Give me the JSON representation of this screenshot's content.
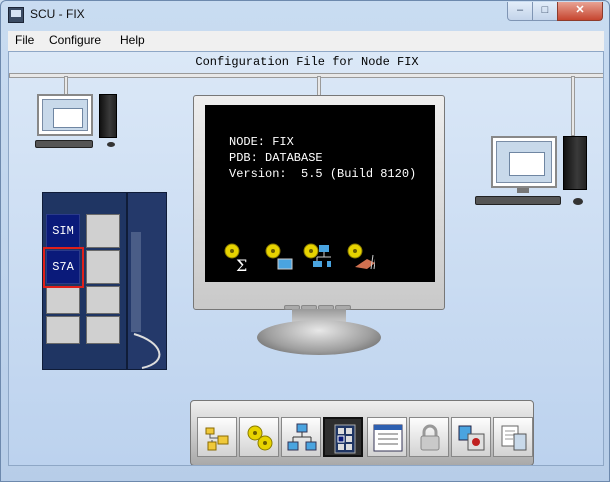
{
  "window": {
    "title": "SCU - FIX",
    "close_glyph": "✕",
    "max_glyph": "□",
    "min_glyph": "–"
  },
  "menu": [
    "File",
    "Configure",
    "Help"
  ],
  "caption": "Configuration File for Node FIX",
  "screen": {
    "node": "NODE: FIX",
    "pdb": "PDB: DATABASE",
    "version": "Version:  5.5 (Build 8120)",
    "sigma": "Σ"
  },
  "plc": {
    "slot_sim": "SIM",
    "slot_s7a": "S7A",
    "highlighted_slot": "S7A"
  },
  "toolbar": {
    "buttons": [
      {
        "name": "path-config-icon"
      },
      {
        "name": "alarm-config-icon"
      },
      {
        "name": "network-config-icon"
      },
      {
        "name": "scada-config-icon",
        "active": true
      },
      {
        "name": "task-config-icon"
      },
      {
        "name": "security-icon"
      },
      {
        "name": "sql-config-icon"
      },
      {
        "name": "local-startup-icon"
      }
    ]
  },
  "colors": {
    "highlight": "#e0201a",
    "slot_blue": "#0a1a7a",
    "screen_bg": "#000000",
    "alarm_yellow": "#e7d300"
  }
}
